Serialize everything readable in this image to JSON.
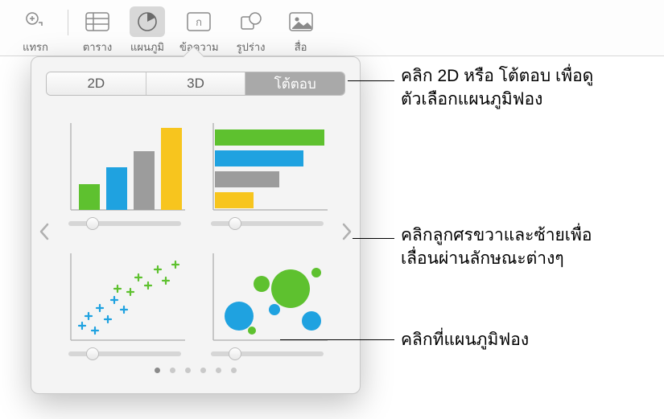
{
  "toolbar": {
    "items": [
      {
        "label": "แทรก",
        "icon": "insert"
      },
      {
        "label": "ตาราง",
        "icon": "table"
      },
      {
        "label": "แผนภูมิ",
        "icon": "chart",
        "active": true
      },
      {
        "label": "ข้อความ",
        "icon": "text"
      },
      {
        "label": "รูปร่าง",
        "icon": "shape"
      },
      {
        "label": "สื่อ",
        "icon": "media"
      }
    ]
  },
  "popover": {
    "segments": {
      "d2": "2D",
      "d3": "3D",
      "interactive": "โต้ตอบ"
    },
    "selected_segment": "interactive",
    "page_count": 6,
    "active_page": 0
  },
  "callouts": {
    "c1_l1": "คลิก 2D หรือ โต้ตอบ เพื่อดู",
    "c1_l2": "ตัวเลือกแผนภูมิฟอง",
    "c2_l1": "คลิกลูกศรขวาและซ้ายเพื่อ",
    "c2_l2": "เลื่อนผ่านลักษณะต่างๆ",
    "c3": "คลิกที่แผนภูมิฟอง"
  },
  "colors": {
    "green": "#5ec12f",
    "blue": "#1fa2e0",
    "yellow": "#f7c51e",
    "gray": "#9c9c9c"
  }
}
